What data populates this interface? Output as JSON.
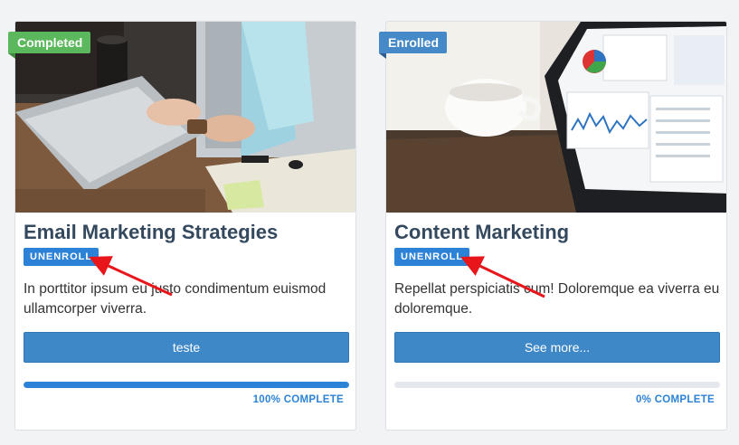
{
  "courses": [
    {
      "status": "Completed",
      "status_color": "#5cb85c",
      "title": "Email Marketing Strategies",
      "unenroll_label": "UNENROLL",
      "description": "In porttitor ipsum eu justo condimentum euismod ullamcorper viverra.",
      "button_label": "teste",
      "progress": 100,
      "progress_label": "100% COMPLETE"
    },
    {
      "status": "Enrolled",
      "status_color": "#4689c8",
      "title": "Content Marketing",
      "unenroll_label": "UNENROLL",
      "description": "Repellat perspiciatis cum! Doloremque ea viverra eu doloremque.",
      "button_label": "See more...",
      "progress": 0,
      "progress_label": "0% COMPLETE"
    }
  ],
  "colors": {
    "accent": "#2c82d6",
    "annotation_arrow": "#e8161b"
  }
}
